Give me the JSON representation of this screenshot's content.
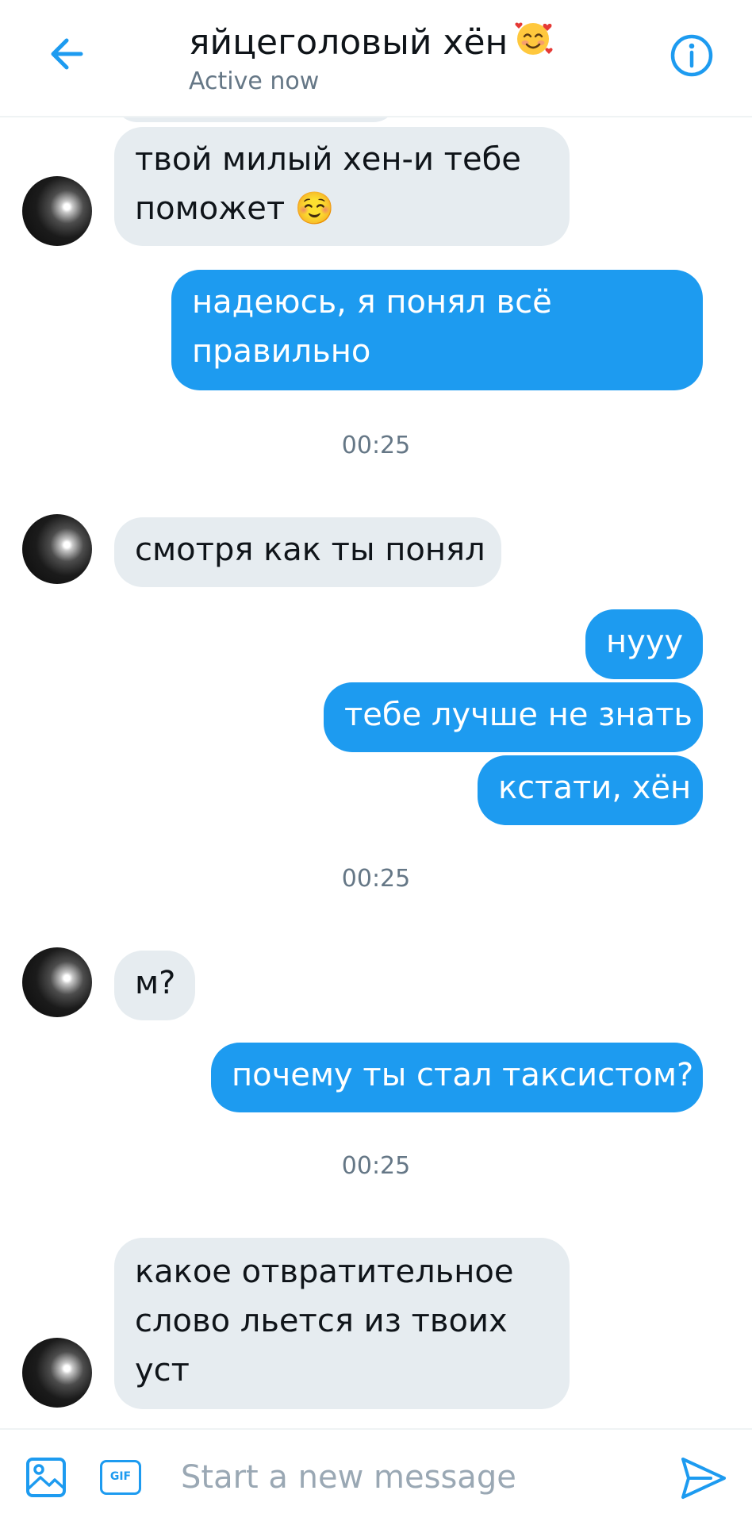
{
  "header": {
    "title": "яйцеголовый хён",
    "status": "Active now"
  },
  "messages": [
    {
      "from": "them",
      "lines": [
        "твой милый хен-и тебе",
        "поможет ☺️"
      ]
    },
    {
      "from": "me",
      "lines": [
        "надеюсь, я понял всё",
        "правильно"
      ]
    },
    {
      "time": "00:25"
    },
    {
      "from": "them",
      "lines": [
        "смотря как ты понял"
      ]
    },
    {
      "from": "me",
      "lines": [
        "нууу"
      ]
    },
    {
      "from": "me",
      "lines": [
        "тебе лучше не знать"
      ]
    },
    {
      "from": "me",
      "lines": [
        "кстати, хён"
      ]
    },
    {
      "time": "00:25"
    },
    {
      "from": "them",
      "lines": [
        "м?"
      ]
    },
    {
      "from": "me",
      "lines": [
        "почему ты стал таксистом?"
      ]
    },
    {
      "time": "00:25"
    },
    {
      "from": "them",
      "lines": [
        "какое отвратительное",
        "слово льется из твоих",
        "уст"
      ]
    }
  ],
  "composer": {
    "placeholder": "Start a new message",
    "gif_label": "GIF"
  },
  "colors": {
    "accent": "#1d9bf0",
    "incoming_bubble": "#e6ecf0",
    "muted_text": "#657786"
  },
  "icons": [
    "back-arrow-icon",
    "info-icon",
    "image-icon",
    "gif-icon",
    "send-icon",
    "smiling-face-with-hearts-emoji"
  ]
}
